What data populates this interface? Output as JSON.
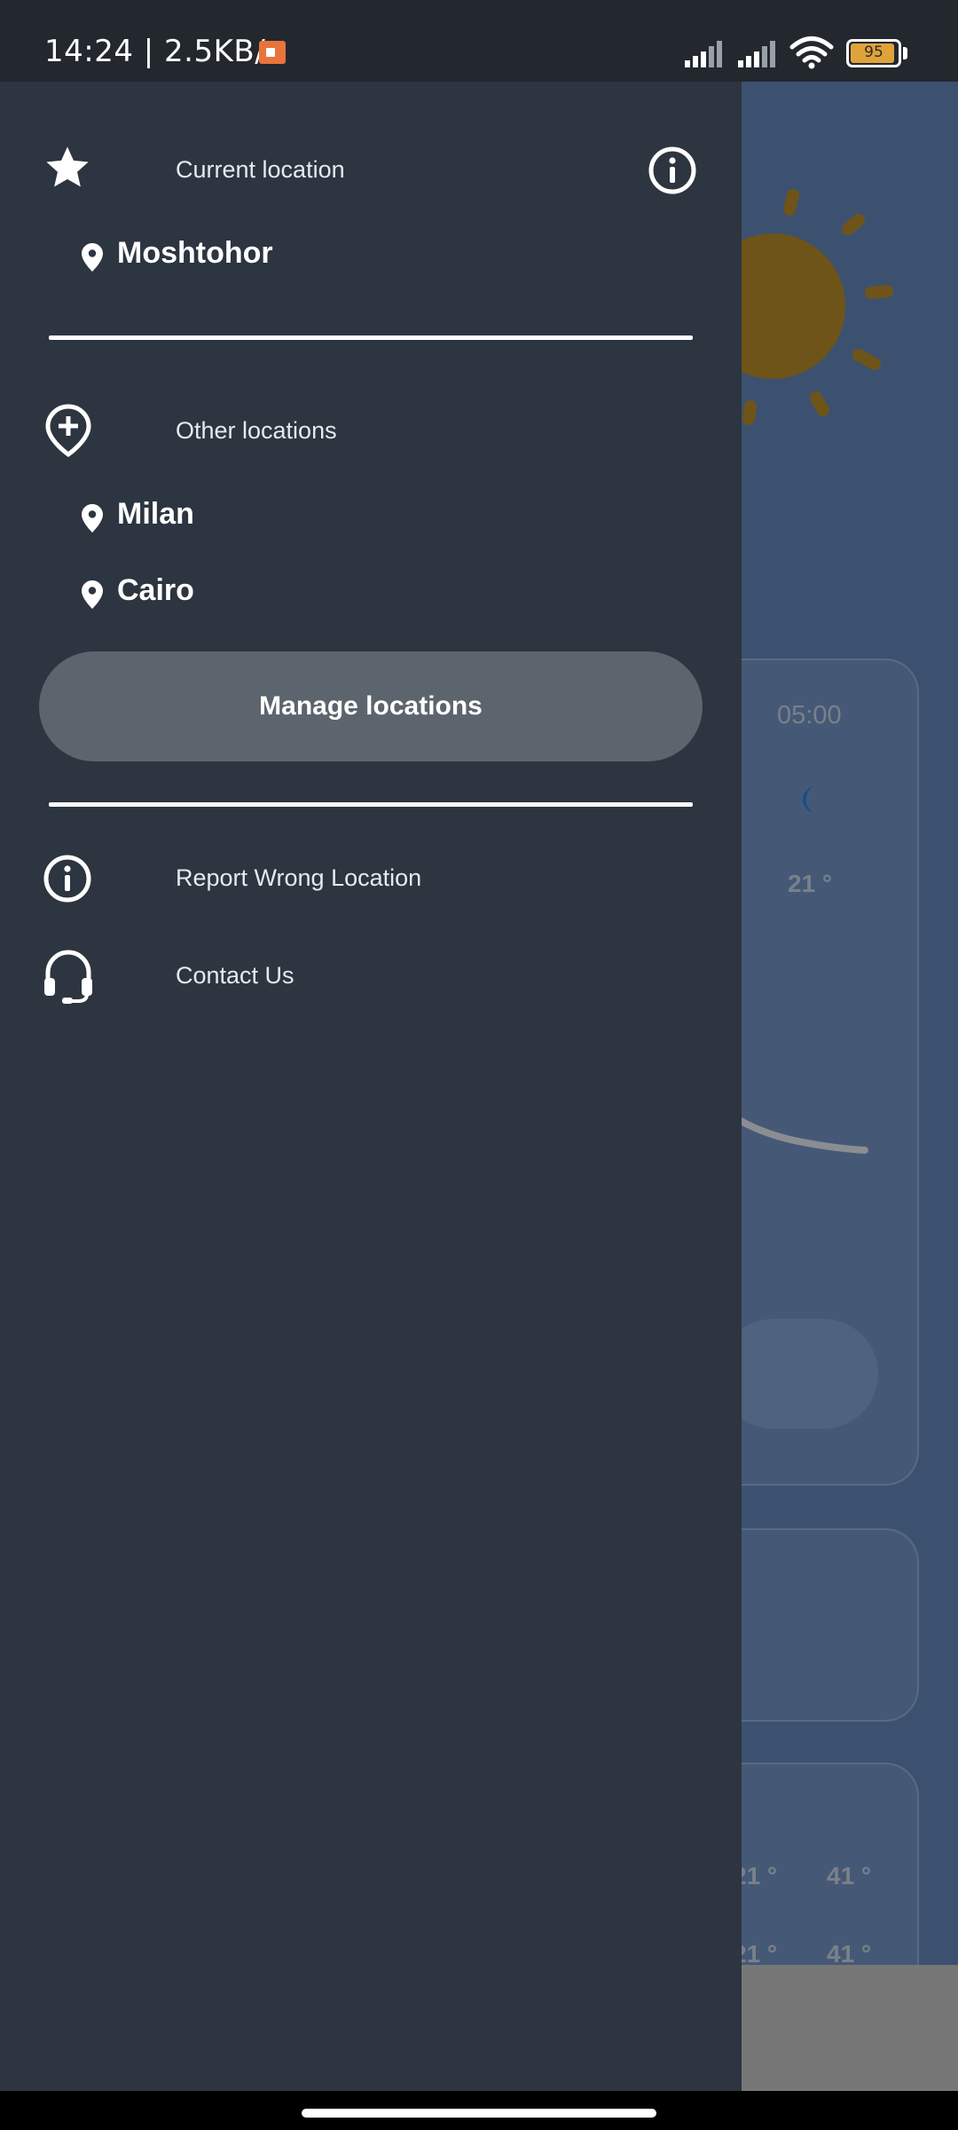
{
  "status_bar": {
    "time_speed": "14:24 | 2.5KB/s",
    "battery_level": "95",
    "battery_fraction": 0.95
  },
  "drawer": {
    "current_section": {
      "label": "Current location",
      "icon": "star-icon",
      "info_icon": "info-icon",
      "location": "Moshtohor"
    },
    "other_section": {
      "label": "Other locations",
      "icon": "add-location-icon",
      "locations": [
        "Milan",
        "Cairo"
      ]
    },
    "manage_button_label": "Manage locations",
    "menu_items": [
      {
        "label": "Report Wrong Location",
        "icon": "info-icon"
      },
      {
        "label": "Contact Us",
        "icon": "headset-icon"
      }
    ]
  },
  "background": {
    "hour_time": "05:00",
    "hour_temp": "21 °",
    "daily": [
      {
        "low": "21 °",
        "high": "41 °"
      },
      {
        "low": "21 °",
        "high": "41 °"
      }
    ]
  },
  "colors": {
    "drawer_bg": "#2c3540",
    "app_bg": "#3c5170",
    "status_bg": "#23272e",
    "button_bg": "#5c646d",
    "battery_fill": "#e0a33a"
  }
}
